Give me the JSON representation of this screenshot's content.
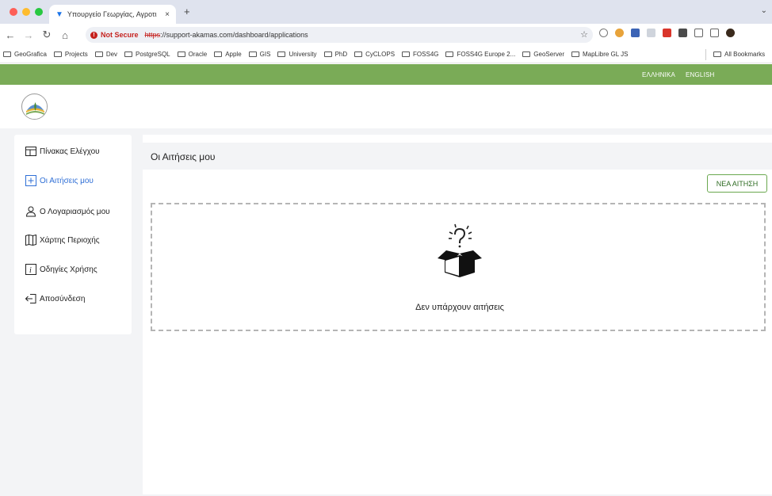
{
  "browser": {
    "tab_title": "Υπουργείο Γεωργίας, Αγροτι",
    "tab_close": "×",
    "new_tab": "+",
    "not_secure": "Not Secure",
    "url_scheme": "https",
    "url_rest": "://support-akamas.com/dashboard/applications",
    "bookmarks": [
      "GeoGrafica",
      "Projects",
      "Dev",
      "PostgreSQL",
      "Oracle",
      "Apple",
      "GIS",
      "University",
      "PhD",
      "CyCLOPS",
      "FOSS4G",
      "FOSS4G Europe 2...",
      "GeoServer",
      "MapLibre GL JS"
    ],
    "all_bookmarks": "All Bookmarks"
  },
  "top_bar": {
    "lang_greek": "ΕΛΛΗΝΙΚΑ",
    "lang_english": "ENGLISH"
  },
  "sidebar": {
    "items": [
      {
        "label": "Πίνακας Ελέγχου",
        "icon": "dashboard-icon",
        "active": false
      },
      {
        "label": "Οι Αιτήσεις μου",
        "icon": "plus-square-icon",
        "active": true
      },
      {
        "label": "Ο Λογαριασμός μου",
        "icon": "user-icon",
        "active": false
      },
      {
        "label": "Χάρτης Περιοχής",
        "icon": "map-icon",
        "active": false
      },
      {
        "label": "Οδηγίες Χρήσης",
        "icon": "info-icon",
        "active": false
      },
      {
        "label": "Αποσύνδεση",
        "icon": "logout-icon",
        "active": false
      }
    ]
  },
  "main": {
    "title": "Οι Αιτήσεις μου",
    "new_button": "ΝΕΑ ΑΙΤΗΣΗ",
    "empty_text": "Δεν υπάρχουν αιτήσεις"
  },
  "colors": {
    "brand_green": "#7aab57",
    "active_link": "#2f6fd6"
  }
}
